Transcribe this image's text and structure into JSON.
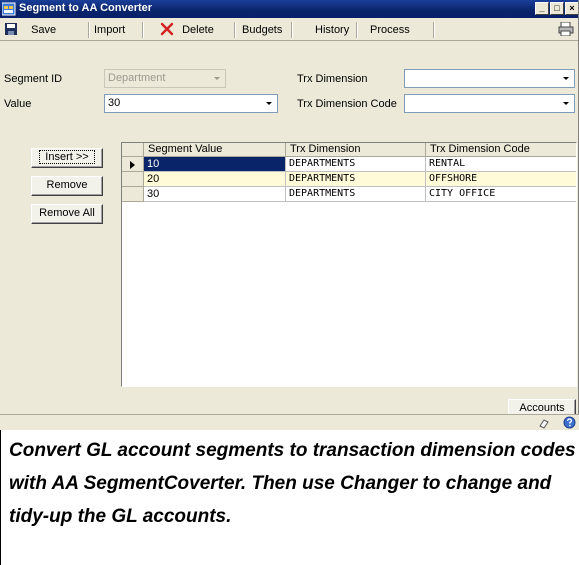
{
  "window": {
    "title": "Segment to AA Converter",
    "controls": {
      "minimize": "_",
      "maximize": "□",
      "close": "×"
    }
  },
  "toolbar": {
    "save_label": "Save",
    "import_label": "Import",
    "delete_label": "Delete",
    "budgets_label": "Budgets",
    "history_label": "History",
    "process_label": "Process"
  },
  "form": {
    "segment_id_label": "Segment ID",
    "segment_id_value": "Department",
    "value_label": "Value",
    "value_value": "30",
    "trx_dimension_label": "Trx Dimension",
    "trx_dimension_value": "",
    "trx_dimension_code_label": "Trx Dimension Code",
    "trx_dimension_code_value": ""
  },
  "buttons": {
    "insert_label": "Insert >>",
    "remove_label": "Remove",
    "remove_all_label": "Remove All",
    "accounts_label": "Accounts"
  },
  "grid": {
    "columns": [
      "Segment Value",
      "Trx Dimension",
      "Trx Dimension Code"
    ],
    "rows": [
      {
        "segment_value": "10",
        "trx_dimension": "DEPARTMENTS",
        "trx_dimension_code": "RENTAL"
      },
      {
        "segment_value": "20",
        "trx_dimension": "DEPARTMENTS",
        "trx_dimension_code": "OFFSHORE"
      },
      {
        "segment_value": "30",
        "trx_dimension": "DEPARTMENTS",
        "trx_dimension_code": "CITY OFFICE"
      }
    ]
  },
  "caption": {
    "text": "Convert GL account segments to transaction dimension codes with AA SegmentCoverter. Then use Changer to change and tidy-up the GL accounts."
  },
  "colors": {
    "title_bar": "#0a246a",
    "window_bg": "#ece9d8",
    "selected_cell": "#0a246a",
    "highlight_row": "#fffbd9"
  }
}
